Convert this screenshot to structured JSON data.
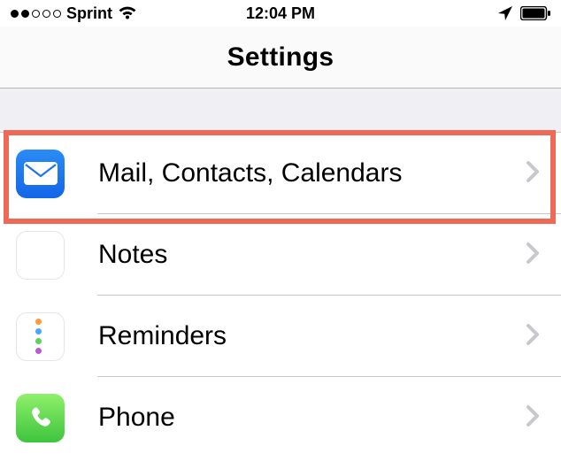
{
  "statusBar": {
    "carrier": "Sprint",
    "time": "12:04 PM"
  },
  "header": {
    "title": "Settings"
  },
  "rows": {
    "mail": {
      "label": "Mail, Contacts, Calendars"
    },
    "notes": {
      "label": "Notes"
    },
    "reminders": {
      "label": "Reminders"
    },
    "phone": {
      "label": "Phone"
    }
  }
}
